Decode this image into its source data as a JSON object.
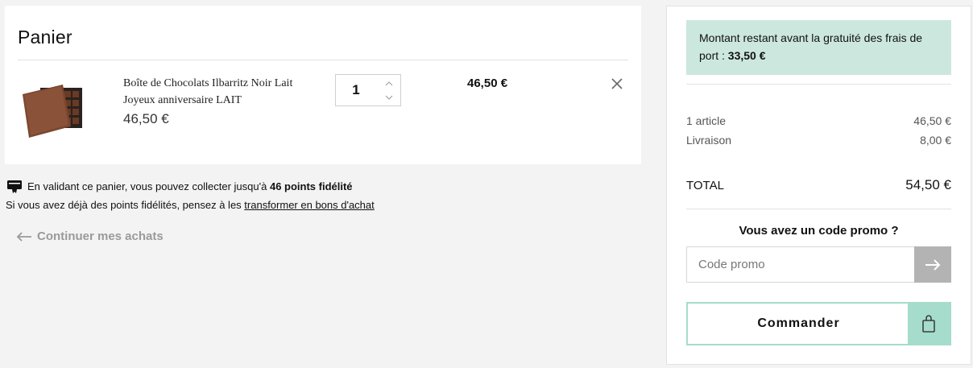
{
  "cart": {
    "title": "Panier",
    "item": {
      "name_line1": "Boîte de Chocolats Ilbarritz Noir Lait",
      "name_line2": "Joyeux anniversaire LAIT",
      "unit_price": "46,50 €",
      "quantity": "1",
      "line_total": "46,50 €"
    }
  },
  "loyalty": {
    "text_prefix": "En validant ce panier, vous pouvez collecter jusqu'à",
    "points": "46 points fidélité",
    "text2_prefix": "Si vous avez déjà des points fidélités, pensez à les",
    "link": "transformer en bons d'achat"
  },
  "continue_label": "Continuer mes achats",
  "summary": {
    "shipping_note": "Montant restant avant la gratuité des frais de port :",
    "shipping_remaining": "33,50 €",
    "articles_label": "1 article",
    "articles_value": "46,50 €",
    "delivery_label": "Livraison",
    "delivery_value": "8,00 €",
    "total_label": "TOTAL",
    "total_value": "54,50 €",
    "promo_title": "Vous avez un code promo ?",
    "promo_placeholder": "Code promo",
    "order_label": "Commander"
  },
  "colors": {
    "accent": "#a6dccb",
    "shipping_bg": "#cce8de",
    "promo_button": "#b3b3b3"
  }
}
